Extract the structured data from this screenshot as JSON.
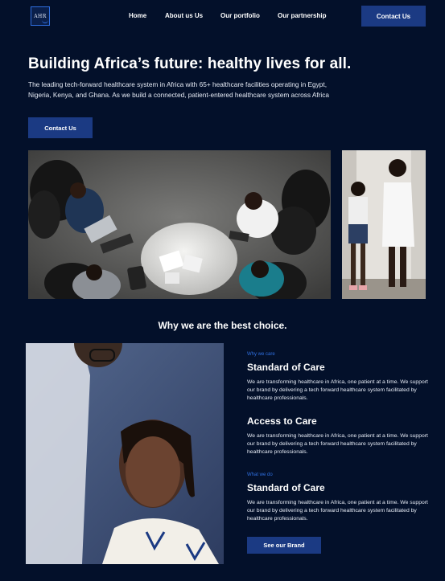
{
  "brand": {
    "logo_text": "AHR"
  },
  "nav": {
    "items": [
      {
        "label": "Home"
      },
      {
        "label": "About us Us"
      },
      {
        "label": "Our portfolio"
      },
      {
        "label": "Our partnership"
      }
    ],
    "contact_label": "Contact Us"
  },
  "hero": {
    "title": "Building Africa’s future: healthy lives for all.",
    "description": "The leading tech-forward healthcare system in Africa with 65+ healthcare facilities operating in Egypt, Nigeria, Kenya, and Ghana. As we build a connected, patient-entered healthcare system across Africa",
    "cta_label": "Contact Us"
  },
  "why": {
    "title": "Why we are the best choice.",
    "features": [
      {
        "eyebrow": "Why we care",
        "title": "Standard of Care",
        "body": "We are transforming healthcare in Africa, one patient at a time. We support our brand by delivering a tech forward healthcare system facilitated by healthcare professionals."
      },
      {
        "eyebrow": "",
        "title": "Access to Care",
        "body": "We are transforming healthcare in Africa, one patient at a time. We support our brand by delivering a tech forward healthcare system facilitated by healthcare professionals."
      },
      {
        "eyebrow": "What we do",
        "title": "Standard of Care",
        "body": "We are transforming healthcare in Africa, one patient at a time. We support our brand by delivering a tech forward healthcare system facilitated by healthcare professionals."
      }
    ],
    "cta_label": "See our Brand"
  },
  "colors": {
    "background": "#03102a",
    "primary_button": "#1b3a83",
    "accent": "#2f6fe0"
  }
}
